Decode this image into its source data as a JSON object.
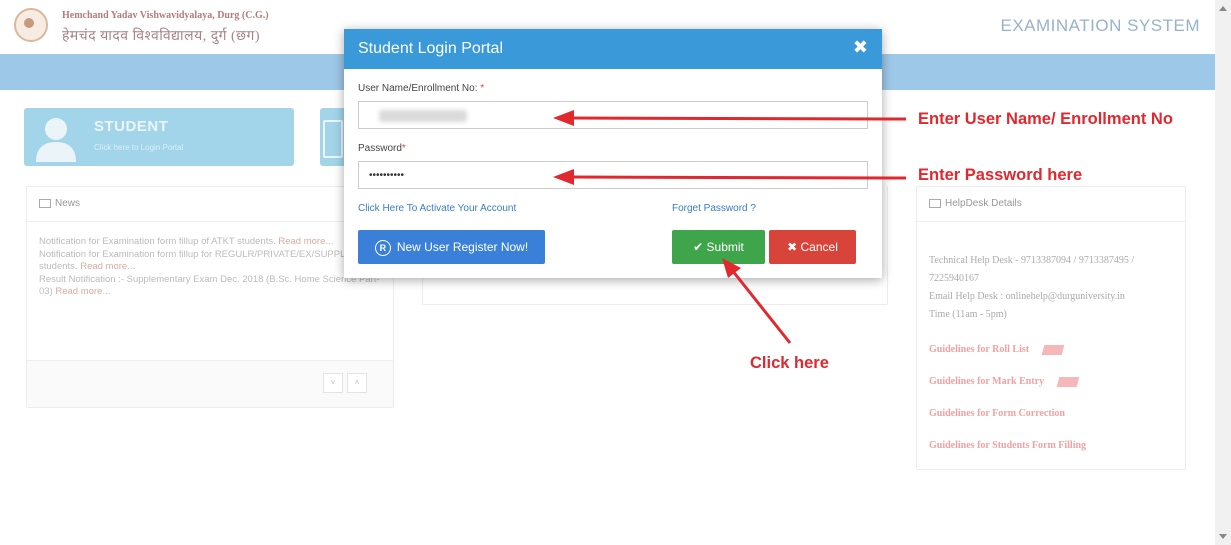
{
  "header": {
    "uni_name_en": "Hemchand Yadav Vishwavidyalaya, Durg (C.G.)",
    "uni_name_hi": "हेमचंद यादव विश्वविद्यालय, दुर्ग (छग)",
    "system_title": "EXAMINATION SYSTEM"
  },
  "student_card": {
    "title": "STUDENT",
    "subtitle": "Click here to Login Portal"
  },
  "news": {
    "heading": "News",
    "items": [
      {
        "text": "Notification for Examination form fillup of ATKT students.",
        "link": "Read more..."
      },
      {
        "text": "Notification for Examination form fillup for REGULR/PRIVATE/EX/SUPPLY students.",
        "link": "Read more..."
      },
      {
        "text": "Result Notification :- Supplementary Exam Dec. 2018 (B.Sc. Home Science Part-03)",
        "link": "Read more..."
      }
    ],
    "prev_symbol": "˅",
    "next_symbol": "˄"
  },
  "helpdesk": {
    "heading": "HelpDesk Details",
    "technical": "Technical Help Desk - 9713387094 / 9713387495 / 7225940167",
    "email": "Email Help Desk : onlinehelp@durguniversity.in",
    "time": "Time (11am - 5pm)",
    "links": [
      "Guidelines for Roll List",
      "Guidelines for Mark Entry",
      "Guidelines for Form Correction",
      "Guidelines for Students Form Filling"
    ]
  },
  "modal": {
    "title": "Student Login Portal",
    "close_symbol": "✖",
    "username_label": "User Name/Enrollment No:",
    "required_mark": "*",
    "password_label": "Password",
    "password_value": "••••••••••",
    "activate_link": "Click Here To Activate Your Account",
    "forgot_link": "Forget Password ?",
    "register_button": "New User Register Now!",
    "register_icon": "R",
    "submit_button": "Submit",
    "submit_icon": "✔",
    "cancel_button": "Cancel",
    "cancel_icon": "✖"
  },
  "annotations": {
    "username_hint": "Enter User Name/ Enrollment No",
    "password_hint": "Enter Password here",
    "click_hint": "Click here",
    "color": "#e0282e"
  }
}
